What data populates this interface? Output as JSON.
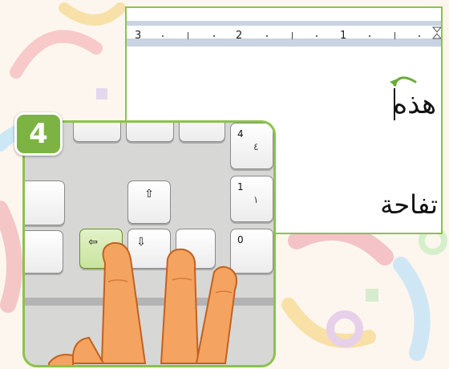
{
  "ruler": {
    "labels": [
      "3",
      "2",
      "1"
    ]
  },
  "document": {
    "word_line1": "هذه",
    "word_line2": "تفاحة"
  },
  "step": {
    "number": "4"
  },
  "keyboard": {
    "keys": {
      "numpad_4": {
        "top": "4",
        "sub": "٤"
      },
      "numpad_1": {
        "top": "1",
        "sub": "١"
      },
      "numpad_0": {
        "top": "0"
      },
      "arrow_up": "⇧",
      "arrow_left": "⇦",
      "arrow_down": "⇩"
    },
    "active_key": "arrow_left"
  },
  "colors": {
    "accent_green": "#8bc34a",
    "badge_green": "#7cb342",
    "hand_orange": "#f4a460",
    "cursor_arrow": "#6aaa3a"
  }
}
